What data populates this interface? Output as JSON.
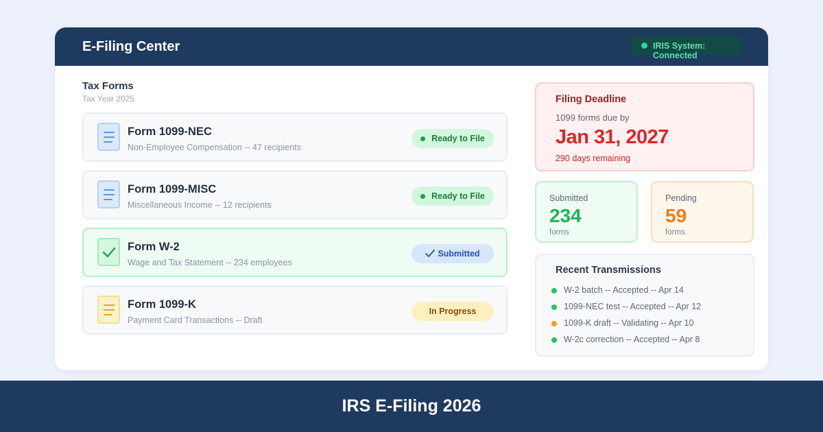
{
  "header": {
    "title": "E-Filing Center",
    "status": {
      "label": "IRIS System: Connected",
      "color": "#34d399"
    }
  },
  "tax_forms": {
    "title": "Tax Forms",
    "subtitle": "Tax Year 2025",
    "forms": [
      {
        "name": "Form 1099-NEC",
        "description": "Non-Employee Compensation -- 47 recipients",
        "status": "Ready to File",
        "icon": "document-icon"
      },
      {
        "name": "Form 1099-MISC",
        "description": "Miscellaneous Income -- 12 recipients",
        "status": "Ready to File",
        "icon": "document-icon"
      },
      {
        "name": "Form W-2",
        "description": "Wage and Tax Statement -- 234 employees",
        "status": "Submitted",
        "icon": "checkmark-icon"
      },
      {
        "name": "Form 1099-K",
        "description": "Payment Card Transactions -- Draft",
        "status": "In Progress",
        "icon": "document-icon"
      }
    ]
  },
  "deadline": {
    "title": "Filing Deadline",
    "subtitle": "1099 forms due by",
    "date": "Jan 31, 2027",
    "remaining": "290 days remaining"
  },
  "stats": {
    "submitted": {
      "label": "Submitted",
      "value": "234",
      "unit": "forms",
      "color": "#1fb557"
    },
    "pending": {
      "label": "Pending",
      "value": "59",
      "unit": "forms",
      "color": "#f07c1b"
    }
  },
  "recent": {
    "title": "Recent Transmissions",
    "items": [
      {
        "text": "W-2 batch -- Accepted -- Apr 14",
        "color": "#22c55e"
      },
      {
        "text": "1099-NEC test -- Accepted -- Apr 12",
        "color": "#22c55e"
      },
      {
        "text": "1099-K draft -- Validating -- Apr 10",
        "color": "#f59e0b"
      },
      {
        "text": "W-2c correction -- Accepted -- Apr 8",
        "color": "#22c55e"
      }
    ]
  },
  "footer": {
    "text": "IRS E-Filing 2026"
  }
}
